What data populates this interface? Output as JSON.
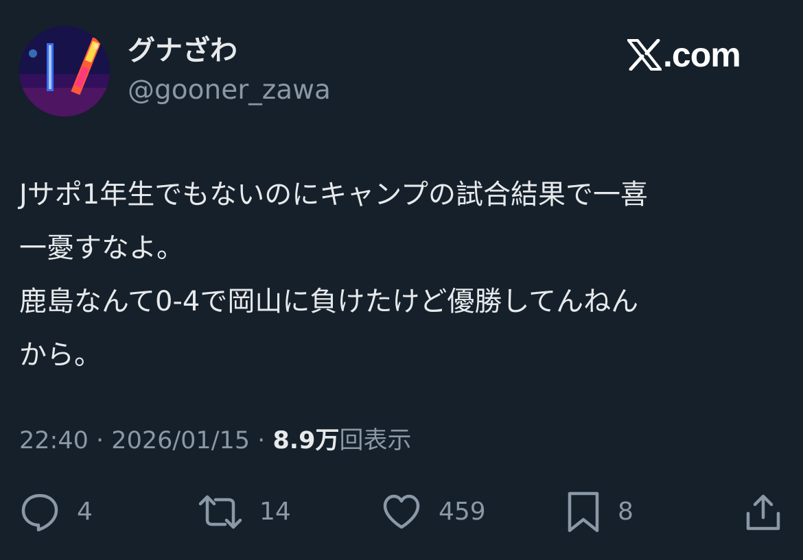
{
  "user": {
    "display_name": "グナざわ",
    "handle": "@gooner_zawa",
    "avatar_icon": "avatar-penlight-photo"
  },
  "brand": {
    "text": ".com",
    "icon": "x-logo-icon"
  },
  "tweet": {
    "lines": [
      "Jサポ1年生でもないのにキャンプの試合結果で一喜",
      "一憂すなよ。",
      "鹿島なんて0-4で岡山に負けたけど優勝してんねん",
      "から。"
    ]
  },
  "meta": {
    "time": "22:40",
    "separator": "·",
    "date": "2026/01/15",
    "views_count": "8.9万",
    "views_label": "回表示"
  },
  "actions": {
    "replies": {
      "icon": "reply-icon",
      "count": "4"
    },
    "retweets": {
      "icon": "retweet-icon",
      "count": "14"
    },
    "likes": {
      "icon": "heart-icon",
      "count": "459"
    },
    "bookmarks": {
      "icon": "bookmark-icon",
      "count": "8"
    },
    "share": {
      "icon": "share-icon"
    }
  },
  "colors": {
    "background": "#15202b",
    "primary_text": "#e7e9ea",
    "secondary_text": "#8b98a5"
  }
}
